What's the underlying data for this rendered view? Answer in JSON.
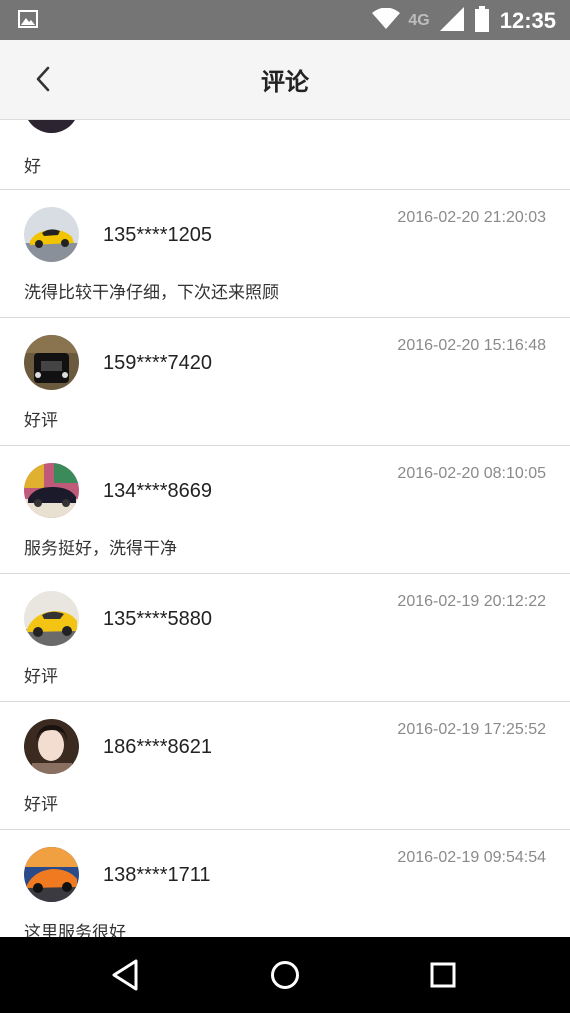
{
  "status_bar": {
    "network": "4G",
    "time": "12:35"
  },
  "header": {
    "title": "评论"
  },
  "partial_comment": {
    "content": "好"
  },
  "comments": [
    {
      "user": "135****1205",
      "date": "2016-02-20 21:20:03",
      "content": "洗得比较干净仔细，下次还来照顾",
      "avatar": "yellow-sports-car"
    },
    {
      "user": "159****7420",
      "date": "2016-02-20 15:16:48",
      "content": "好评",
      "avatar": "black-luxury-car"
    },
    {
      "user": "134****8669",
      "date": "2016-02-20 08:10:05",
      "content": "服务挺好，洗得干净",
      "avatar": "graffiti-car"
    },
    {
      "user": "135****5880",
      "date": "2016-02-19 20:12:22",
      "content": "好评",
      "avatar": "yellow-lamborghini"
    },
    {
      "user": "186****8621",
      "date": "2016-02-19 17:25:52",
      "content": "好评",
      "avatar": "woman-portrait"
    },
    {
      "user": "138****1711",
      "date": "2016-02-19 09:54:54",
      "content": "这里服务很好",
      "avatar": "orange-sports-car"
    }
  ]
}
